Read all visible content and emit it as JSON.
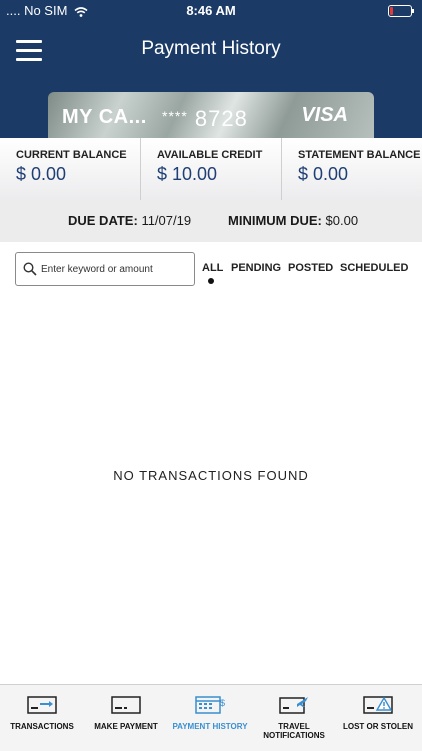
{
  "status_bar": {
    "carrier": "No SIM",
    "time": "8:46 AM"
  },
  "header": {
    "title": "Payment History"
  },
  "card": {
    "name": "MY CA...",
    "mask": "****",
    "last4": "8728",
    "brand": "VISA"
  },
  "balances": [
    {
      "label": "CURRENT BALANCE",
      "value": "$ 0.00"
    },
    {
      "label": "AVAILABLE CREDIT",
      "value": "$ 10.00"
    },
    {
      "label": "STATEMENT BALANCE",
      "value": "$ 0.00"
    }
  ],
  "due": {
    "due_label": "DUE DATE:",
    "due_value": "11/07/19",
    "min_label": "MINIMUM DUE:",
    "min_value": "$0.00"
  },
  "search": {
    "placeholder": "Enter keyword or amount"
  },
  "filter_tabs": [
    {
      "label": "ALL",
      "selected": true
    },
    {
      "label": "PENDING",
      "selected": false
    },
    {
      "label": "POSTED",
      "selected": false
    },
    {
      "label": "SCHEDULED",
      "selected": false
    }
  ],
  "empty_message": "NO TRANSACTIONS FOUND",
  "bottom_nav": [
    {
      "label": "TRANSACTIONS",
      "icon": "card-arrow-icon",
      "active": false
    },
    {
      "label": "MAKE PAYMENT",
      "icon": "card-icon",
      "active": false
    },
    {
      "label": "PAYMENT HISTORY",
      "icon": "calendar-dollar-icon",
      "active": true
    },
    {
      "label": "TRAVEL NOTIFICATIONS",
      "icon": "card-plane-icon",
      "active": false
    },
    {
      "label": "LOST OR STOLEN",
      "icon": "card-warning-icon",
      "active": false
    }
  ],
  "colors": {
    "header": "#1b3a66",
    "balance_value": "#1f3f74",
    "active_nav": "#3a8fd0"
  }
}
